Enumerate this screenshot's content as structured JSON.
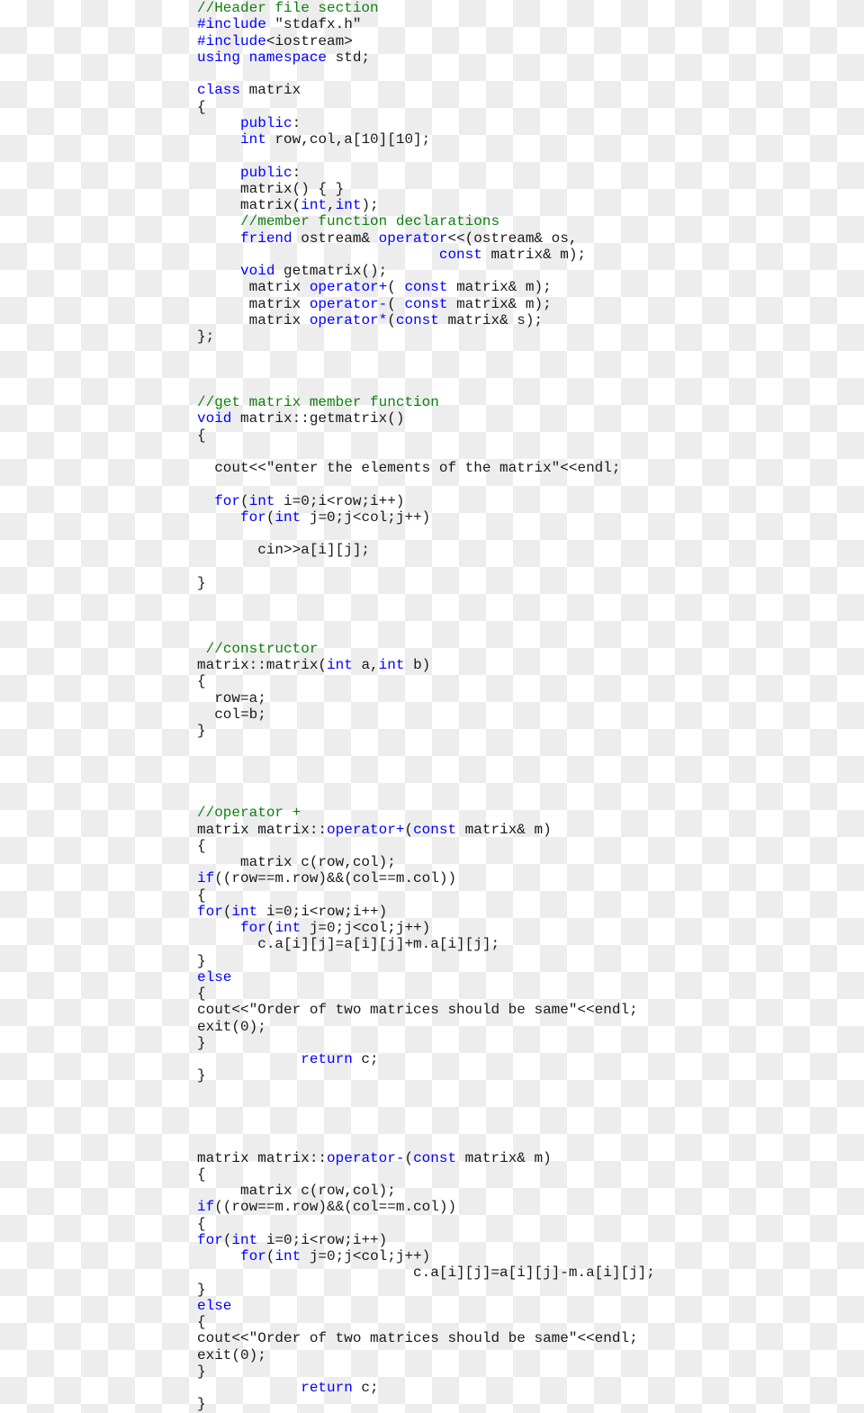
{
  "document": {
    "kind": "source-code-listing",
    "language": "C++",
    "title": "matrix class with operator overloading",
    "colors": {
      "keyword": "#0000ff",
      "comment": "#108010",
      "plain": "#1a1a1a",
      "background_light": "#ffffff",
      "background_dark": "#ededed"
    }
  },
  "code": {
    "lines": [
      [
        [
          "cm",
          "//Header file section"
        ]
      ],
      [
        [
          "kw",
          "#include"
        ],
        [
          "pl",
          " \"stdafx.h\""
        ]
      ],
      [
        [
          "kw",
          "#include"
        ],
        [
          "pl",
          "<iostream>"
        ]
      ],
      [
        [
          "kw",
          "using namespace"
        ],
        [
          "pl",
          " std;"
        ]
      ],
      [
        [
          "pl",
          ""
        ]
      ],
      [
        [
          "kw",
          "class"
        ],
        [
          "pl",
          " matrix"
        ]
      ],
      [
        [
          "pl",
          "{"
        ]
      ],
      [
        [
          "pl",
          "     "
        ],
        [
          "kw",
          "public"
        ],
        [
          "pl",
          ":"
        ]
      ],
      [
        [
          "pl",
          "     "
        ],
        [
          "kw",
          "int"
        ],
        [
          "pl",
          " row,col,a[10][10];"
        ]
      ],
      [
        [
          "pl",
          ""
        ]
      ],
      [
        [
          "pl",
          "     "
        ],
        [
          "kw",
          "public"
        ],
        [
          "pl",
          ":"
        ]
      ],
      [
        [
          "pl",
          "     matrix() { }"
        ]
      ],
      [
        [
          "pl",
          "     matrix("
        ],
        [
          "kw",
          "int"
        ],
        [
          "pl",
          ","
        ],
        [
          "kw",
          "int"
        ],
        [
          "pl",
          ");"
        ]
      ],
      [
        [
          "pl",
          "     "
        ],
        [
          "cm",
          "//member function declarations"
        ]
      ],
      [
        [
          "pl",
          "     "
        ],
        [
          "kw",
          "friend"
        ],
        [
          "pl",
          " ostream& "
        ],
        [
          "kw",
          "operator"
        ],
        [
          "pl",
          "<<(ostream& os,"
        ]
      ],
      [
        [
          "pl",
          "                            "
        ],
        [
          "kw",
          "const"
        ],
        [
          "pl",
          " matrix& m);"
        ]
      ],
      [
        [
          "pl",
          "     "
        ],
        [
          "kw",
          "void"
        ],
        [
          "pl",
          " getmatrix();"
        ]
      ],
      [
        [
          "pl",
          "      matrix "
        ],
        [
          "kw",
          "operator+"
        ],
        [
          "pl",
          "( "
        ],
        [
          "kw",
          "const"
        ],
        [
          "pl",
          " matrix& m);"
        ]
      ],
      [
        [
          "pl",
          "      matrix "
        ],
        [
          "kw",
          "operator-"
        ],
        [
          "pl",
          "( "
        ],
        [
          "kw",
          "const"
        ],
        [
          "pl",
          " matrix& m);"
        ]
      ],
      [
        [
          "pl",
          "      matrix "
        ],
        [
          "kw",
          "operator*"
        ],
        [
          "pl",
          "("
        ],
        [
          "kw",
          "const"
        ],
        [
          "pl",
          " matrix& s);"
        ]
      ],
      [
        [
          "pl",
          "};"
        ]
      ],
      [
        [
          "pl",
          ""
        ]
      ],
      [
        [
          "pl",
          ""
        ]
      ],
      [
        [
          "pl",
          ""
        ]
      ],
      [
        [
          "cm",
          "//get matrix member function"
        ]
      ],
      [
        [
          "kw",
          "void"
        ],
        [
          "pl",
          " matrix::getmatrix()"
        ]
      ],
      [
        [
          "pl",
          "{"
        ]
      ],
      [
        [
          "pl",
          ""
        ]
      ],
      [
        [
          "pl",
          "  cout<<\"enter the elements of the matrix\"<<endl;"
        ]
      ],
      [
        [
          "pl",
          ""
        ]
      ],
      [
        [
          "pl",
          "  "
        ],
        [
          "kw",
          "for"
        ],
        [
          "pl",
          "("
        ],
        [
          "kw",
          "int"
        ],
        [
          "pl",
          " i=0;i<row;i++)"
        ]
      ],
      [
        [
          "pl",
          "     "
        ],
        [
          "kw",
          "for"
        ],
        [
          "pl",
          "("
        ],
        [
          "kw",
          "int"
        ],
        [
          "pl",
          " j=0;j<col;j++)"
        ]
      ],
      [
        [
          "pl",
          ""
        ]
      ],
      [
        [
          "pl",
          "       cin>>a[i][j];"
        ]
      ],
      [
        [
          "pl",
          ""
        ]
      ],
      [
        [
          "pl",
          "}"
        ]
      ],
      [
        [
          "pl",
          ""
        ]
      ],
      [
        [
          "pl",
          ""
        ]
      ],
      [
        [
          "pl",
          ""
        ]
      ],
      [
        [
          "pl",
          " "
        ],
        [
          "cm",
          "//constructor"
        ]
      ],
      [
        [
          "pl",
          "matrix::matrix("
        ],
        [
          "kw",
          "int"
        ],
        [
          "pl",
          " a,"
        ],
        [
          "kw",
          "int"
        ],
        [
          "pl",
          " b)"
        ]
      ],
      [
        [
          "pl",
          "{"
        ]
      ],
      [
        [
          "pl",
          "  row=a;"
        ]
      ],
      [
        [
          "pl",
          "  col=b;"
        ]
      ],
      [
        [
          "pl",
          "}"
        ]
      ],
      [
        [
          "pl",
          ""
        ]
      ],
      [
        [
          "pl",
          ""
        ]
      ],
      [
        [
          "pl",
          ""
        ]
      ],
      [
        [
          "pl",
          ""
        ]
      ],
      [
        [
          "cm",
          "//operator +"
        ]
      ],
      [
        [
          "pl",
          "matrix matrix::"
        ],
        [
          "kw",
          "operator+"
        ],
        [
          "pl",
          "("
        ],
        [
          "kw",
          "const"
        ],
        [
          "pl",
          " matrix& m)"
        ]
      ],
      [
        [
          "pl",
          "{"
        ]
      ],
      [
        [
          "pl",
          "     matrix c(row,col);"
        ]
      ],
      [
        [
          "kw",
          "if"
        ],
        [
          "pl",
          "((row==m.row)&&(col==m.col))"
        ]
      ],
      [
        [
          "pl",
          "{"
        ]
      ],
      [
        [
          "kw",
          "for"
        ],
        [
          "pl",
          "("
        ],
        [
          "kw",
          "int"
        ],
        [
          "pl",
          " i=0;i<row;i++)"
        ]
      ],
      [
        [
          "pl",
          "     "
        ],
        [
          "kw",
          "for"
        ],
        [
          "pl",
          "("
        ],
        [
          "kw",
          "int"
        ],
        [
          "pl",
          " j=0;j<col;j++)"
        ]
      ],
      [
        [
          "pl",
          "       c.a[i][j]=a[i][j]+m.a[i][j];"
        ]
      ],
      [
        [
          "pl",
          "}"
        ]
      ],
      [
        [
          "kw",
          "else"
        ]
      ],
      [
        [
          "pl",
          "{"
        ]
      ],
      [
        [
          "pl",
          "cout<<\"Order of two matrices should be same\"<<endl;"
        ]
      ],
      [
        [
          "pl",
          "exit(0);"
        ]
      ],
      [
        [
          "pl",
          "}"
        ]
      ],
      [
        [
          "pl",
          "            "
        ],
        [
          "kw",
          "return"
        ],
        [
          "pl",
          " c;"
        ]
      ],
      [
        [
          "pl",
          "}"
        ]
      ],
      [
        [
          "pl",
          ""
        ]
      ],
      [
        [
          "pl",
          ""
        ]
      ],
      [
        [
          "pl",
          ""
        ]
      ],
      [
        [
          "pl",
          ""
        ]
      ],
      [
        [
          "pl",
          "matrix matrix::"
        ],
        [
          "kw",
          "operator-"
        ],
        [
          "pl",
          "("
        ],
        [
          "kw",
          "const"
        ],
        [
          "pl",
          " matrix& m)"
        ]
      ],
      [
        [
          "pl",
          "{"
        ]
      ],
      [
        [
          "pl",
          "     matrix c(row,col);"
        ]
      ],
      [
        [
          "kw",
          "if"
        ],
        [
          "pl",
          "((row==m.row)&&(col==m.col))"
        ]
      ],
      [
        [
          "pl",
          "{"
        ]
      ],
      [
        [
          "kw",
          "for"
        ],
        [
          "pl",
          "("
        ],
        [
          "kw",
          "int"
        ],
        [
          "pl",
          " i=0;i<row;i++)"
        ]
      ],
      [
        [
          "pl",
          "     "
        ],
        [
          "kw",
          "for"
        ],
        [
          "pl",
          "("
        ],
        [
          "kw",
          "int"
        ],
        [
          "pl",
          " j=0;j<col;j++)"
        ]
      ],
      [
        [
          "pl",
          "                         c.a[i][j]=a[i][j]-m.a[i][j];"
        ]
      ],
      [
        [
          "pl",
          "}"
        ]
      ],
      [
        [
          "kw",
          "else"
        ]
      ],
      [
        [
          "pl",
          "{"
        ]
      ],
      [
        [
          "pl",
          "cout<<\"Order of two matrices should be same\"<<endl;"
        ]
      ],
      [
        [
          "pl",
          "exit(0);"
        ]
      ],
      [
        [
          "pl",
          "}"
        ]
      ],
      [
        [
          "pl",
          "            "
        ],
        [
          "kw",
          "return"
        ],
        [
          "pl",
          " c;"
        ]
      ],
      [
        [
          "pl",
          "}"
        ]
      ]
    ]
  }
}
